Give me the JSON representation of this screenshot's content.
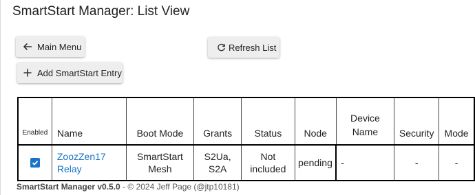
{
  "page": {
    "title": "SmartStart Manager: List View"
  },
  "toolbar": {
    "main_menu_label": "Main Menu",
    "refresh_label": "Refresh List",
    "add_entry_label": "Add SmartStart Entry"
  },
  "table": {
    "headers": [
      "Enabled",
      "Name",
      "Boot Mode",
      "Grants",
      "Status",
      "Node",
      "Device Name",
      "Security",
      "Mode"
    ],
    "rows": [
      {
        "enabled": true,
        "name": "ZoozZen17 Relay",
        "boot_mode": "SmartStart Mesh",
        "grants": "S2Ua, S2A",
        "status": "Not included",
        "node": "pending",
        "device_name": "-",
        "security": "-",
        "mode": "-"
      }
    ]
  },
  "footer": {
    "app_version": "SmartStart Manager v0.5.0",
    "copyright": "- © 2024 Jeff Page (@jtp10181)"
  },
  "colors": {
    "link": "#1a73c8",
    "checkbox": "#1a73c8",
    "button_bg": "#eeeeee"
  },
  "icons": [
    "arrow-left-icon",
    "refresh-icon",
    "plus-icon",
    "check-icon"
  ]
}
